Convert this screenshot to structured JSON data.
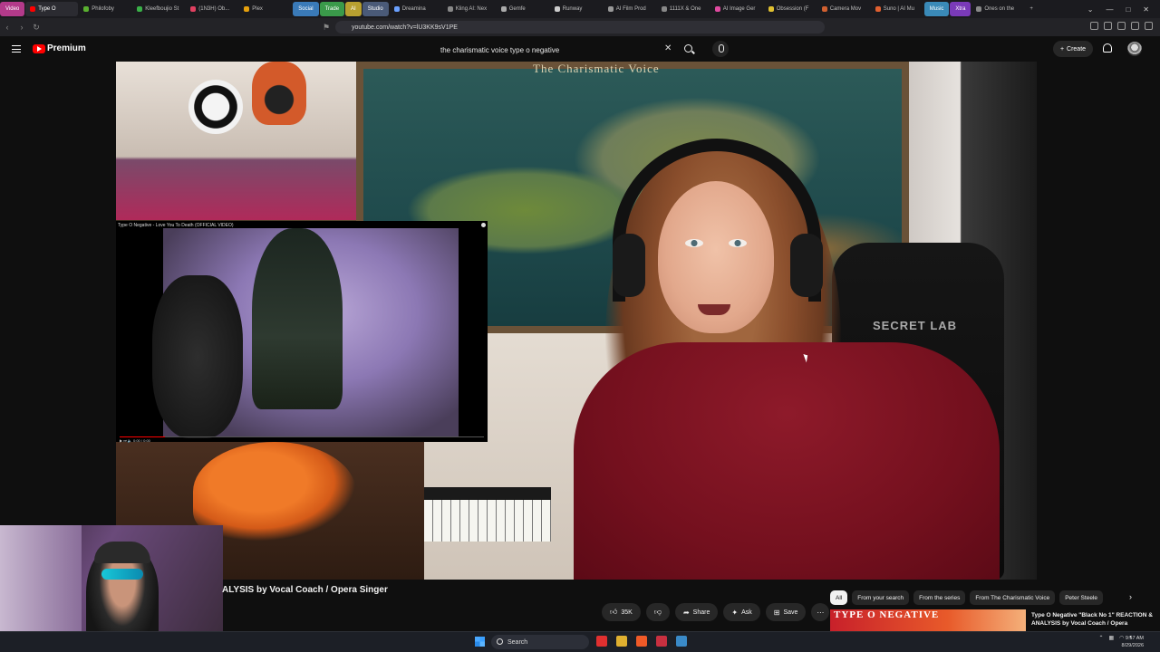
{
  "browser": {
    "tabs": [
      {
        "label": "Video",
        "color": "#b33a8a",
        "group": true
      },
      {
        "label": "Type O",
        "color": "#ff0000",
        "active": true
      },
      {
        "label": "Philofoby",
        "color": "#5ab030"
      },
      {
        "label": "Kleefboujio St",
        "color": "#3ab048"
      },
      {
        "label": "(1N3H) Ob...",
        "color": "#e04060"
      },
      {
        "label": "Plex",
        "color": "#e5a00d"
      },
      {
        "label": "Social",
        "color": "#3a7ab8",
        "group": true
      },
      {
        "label": "Trade",
        "color": "#3a9a4a",
        "group": true
      },
      {
        "label": "AI",
        "color": "#b8a030",
        "group": true
      },
      {
        "label": "Studio",
        "color": "#4a5a78",
        "group": true
      },
      {
        "label": "Dreamina",
        "color": "#6aa0ff"
      },
      {
        "label": "Kling AI: Nex",
        "color": "#888888"
      },
      {
        "label": "Gemfe",
        "color": "#aaaaaa"
      },
      {
        "label": "Runway",
        "color": "#cccccc"
      },
      {
        "label": "AI Film Prod",
        "color": "#999999"
      },
      {
        "label": "1111X & One",
        "color": "#888888"
      },
      {
        "label": "AI Image Ger",
        "color": "#e04aa0"
      },
      {
        "label": "Obsession (F",
        "color": "#e0c030"
      },
      {
        "label": "Camera Mov",
        "color": "#d06030"
      },
      {
        "label": "Suno | AI Mu",
        "color": "#e06030"
      },
      {
        "label": "Music",
        "color": "#3a8ab8",
        "group": true
      },
      {
        "label": "Xtra",
        "color": "#7a3ab8",
        "group": true
      },
      {
        "label": "Ones on the",
        "color": "#888888"
      }
    ],
    "url": "youtube.com/watch?v=lU3KK9sV1PE"
  },
  "youtube": {
    "brand": "Premium",
    "search_query": "the charismatic voice type o negative",
    "create_label": "Create"
  },
  "video": {
    "map_title": "The Charismatic Voice",
    "chair_brand": "SECRET LAB",
    "pip_title": "Type O Negative - Love You To Death (OFFICIAL VIDEO)",
    "pip_time": "0:00 / 0:00",
    "title": "ALYSIS by Vocal Coach / Opera Singer"
  },
  "actions": {
    "like_count": "35K",
    "share_label": "Share",
    "ask_label": "Ask",
    "save_label": "Save"
  },
  "chips": [
    "All",
    "From your search",
    "From the series",
    "From The Charismatic Voice",
    "Peter Steele"
  ],
  "recommendation": {
    "thumb_text": "TYPE O NEGATIVE",
    "title": "Type O Negative \"Black No 1\" REACTION & ANALYSIS by Vocal Coach / Opera"
  },
  "taskbar": {
    "search_label": "Search",
    "time": "9:57 AM",
    "date": "8/29/2026",
    "apps": [
      {
        "name": "app-red",
        "color": "#e03030"
      },
      {
        "name": "app-folder",
        "color": "#e0b030"
      },
      {
        "name": "app-brave",
        "color": "#f05a28"
      },
      {
        "name": "app-news",
        "color": "#c83040"
      },
      {
        "name": "app-steam",
        "color": "#3a8ac8"
      }
    ]
  }
}
